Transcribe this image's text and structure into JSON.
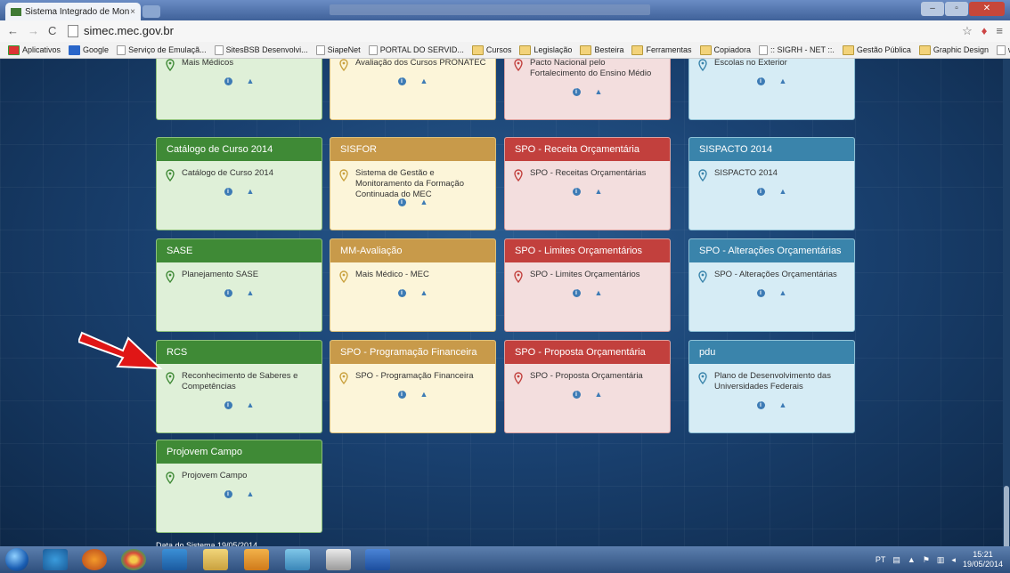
{
  "browser": {
    "tab_title": "Sistema Integrado de Mon",
    "tab_close": "×",
    "url": "simec.mec.gov.br",
    "bookmarks": [
      {
        "label": "Aplicativos",
        "icon": "apps-icon"
      },
      {
        "label": "Google",
        "icon": "google-icon"
      },
      {
        "label": "Serviço de Emulaçã...",
        "icon": "page-icon"
      },
      {
        "label": "SitesBSB Desenvolvi...",
        "icon": "page-icon"
      },
      {
        "label": "SiapeNet",
        "icon": "page-icon"
      },
      {
        "label": "PORTAL DO SERVID...",
        "icon": "page-icon"
      },
      {
        "label": "Cursos",
        "icon": "folder-icon"
      },
      {
        "label": "Legislação",
        "icon": "folder-icon"
      },
      {
        "label": "Besteira",
        "icon": "folder-icon"
      },
      {
        "label": "Ferramentas",
        "icon": "folder-icon"
      },
      {
        "label": "Copiadora",
        "icon": "folder-icon"
      },
      {
        "label": ":: SIGRH - NET ::.",
        "icon": "page-icon"
      },
      {
        "label": "Gestão Pública",
        "icon": "folder-icon"
      },
      {
        "label": "Graphic Design",
        "icon": "folder-icon"
      },
      {
        "label": "www.in.gov.br",
        "icon": "page-icon"
      }
    ],
    "more_bookmarks": "»"
  },
  "cards": [
    {
      "color": "green",
      "header": "",
      "item": "Mais Médicos"
    },
    {
      "color": "yellow",
      "header": "",
      "item": "Avaliação dos Cursos PRONATEC"
    },
    {
      "color": "red",
      "header": "",
      "item": "Pacto Nacional pelo Fortalecimento do Ensino Médio"
    },
    {
      "color": "blue",
      "header": "",
      "item": "Escolas no Exterior"
    },
    {
      "color": "green",
      "header": "Catálogo de Curso 2014",
      "item": "Catálogo de Curso 2014"
    },
    {
      "color": "yellow",
      "header": "SISFOR",
      "item": "Sistema de Gestão e Monitoramento da Formação Continuada do MEC"
    },
    {
      "color": "red",
      "header": "SPO - Receita Orçamentária",
      "item": "SPO - Receitas Orçamentárias"
    },
    {
      "color": "blue",
      "header": "SISPACTO 2014",
      "item": "SISPACTO 2014"
    },
    {
      "color": "green",
      "header": "SASE",
      "item": "Planejamento SASE"
    },
    {
      "color": "yellow",
      "header": "MM-Avaliação",
      "item": "Mais Médico - MEC"
    },
    {
      "color": "red",
      "header": "SPO - Limites Orçamentários",
      "item": "SPO - Limites Orçamentários"
    },
    {
      "color": "blue",
      "header": "SPO - Alterações Orçamentárias",
      "item": "SPO - Alterações Orçamentárias"
    },
    {
      "color": "green",
      "header": "RCS",
      "item": "Reconhecimento de Saberes e Competências"
    },
    {
      "color": "yellow",
      "header": "SPO - Programação Financeira",
      "item": "SPO - Programação Financeira"
    },
    {
      "color": "red",
      "header": "SPO - Proposta Orçamentária",
      "item": "SPO - Proposta Orçamentária"
    },
    {
      "color": "blue",
      "header": "pdu",
      "item": "Plano de Desenvolvimento das Universidades Federais"
    },
    {
      "color": "green",
      "header": "Projovem Campo",
      "item": "Projovem Campo"
    }
  ],
  "system_date": "Data do Sistema 19/05/2014",
  "taskbar": {
    "lang": "PT",
    "time": "15:21",
    "date": "19/05/2014"
  }
}
